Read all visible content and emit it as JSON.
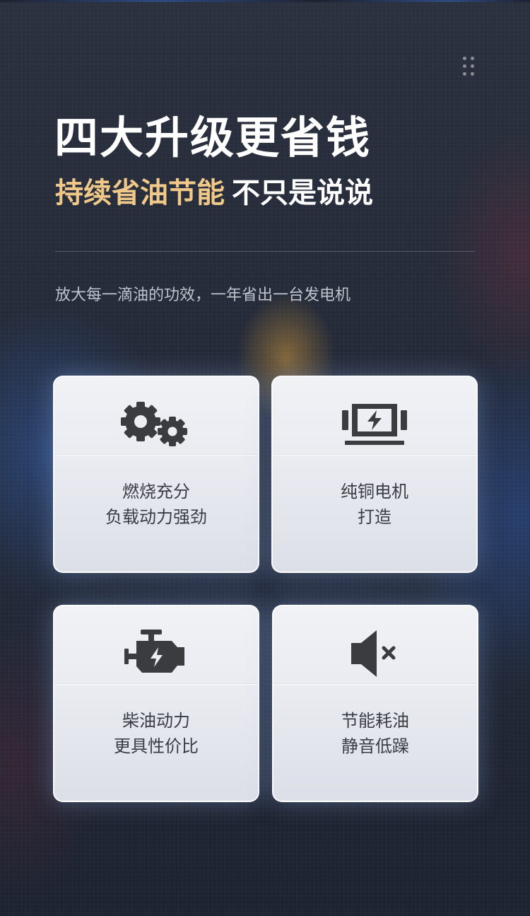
{
  "header": {
    "title": "四大升级更省钱",
    "subtitle_highlight": "持续省油节能",
    "subtitle_rest": "不只是说说",
    "description": "放大每一滴油的功效，一年省出一台发电机"
  },
  "colors": {
    "highlight": "#f0c98a",
    "title": "#ffffff",
    "card_text": "#3a3d44",
    "icon": "#3b3c40"
  },
  "features": [
    {
      "icon": "gears-icon",
      "line1": "燃烧充分",
      "line2": "负载动力强劲"
    },
    {
      "icon": "copper-motor-icon",
      "line1": "纯铜电机",
      "line2": "打造"
    },
    {
      "icon": "diesel-engine-icon",
      "line1": "柴油动力",
      "line2": "更具性价比"
    },
    {
      "icon": "mute-speaker-icon",
      "line1": "节能耗油",
      "line2": "静音低躁"
    }
  ]
}
